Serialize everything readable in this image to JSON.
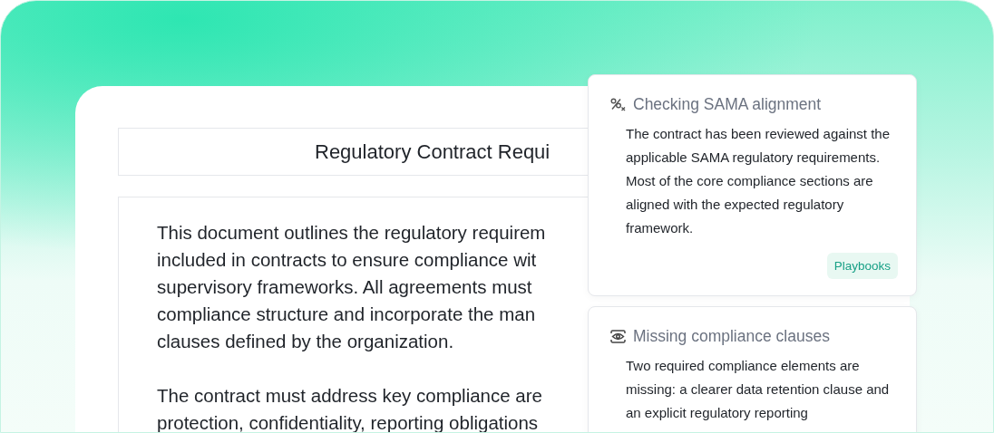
{
  "document": {
    "title": "Regulatory Contract Requi",
    "paragraphs": [
      {
        "lines": [
          "This document outlines the regulatory requirem",
          "included in contracts to ensure compliance wit",
          "supervisory frameworks. All agreements must",
          "compliance structure and incorporate the man",
          "clauses defined by the organization."
        ]
      },
      {
        "lines": [
          "The contract must address key compliance are",
          "protection, confidentiality, reporting obligations"
        ]
      }
    ]
  },
  "cards": [
    {
      "title": "Checking SAMA alignment",
      "body": "The contract has been reviewed against the applicable SAMA regulatory requirements. Most of the core compliance sections are aligned with the expected regulatory framework.",
      "tags": [
        "Playbooks"
      ]
    },
    {
      "title": "Missing compliance clauses",
      "body": "Two required compliance elements are missing: a clearer data retention clause and an explicit regulatory reporting"
    }
  ]
}
